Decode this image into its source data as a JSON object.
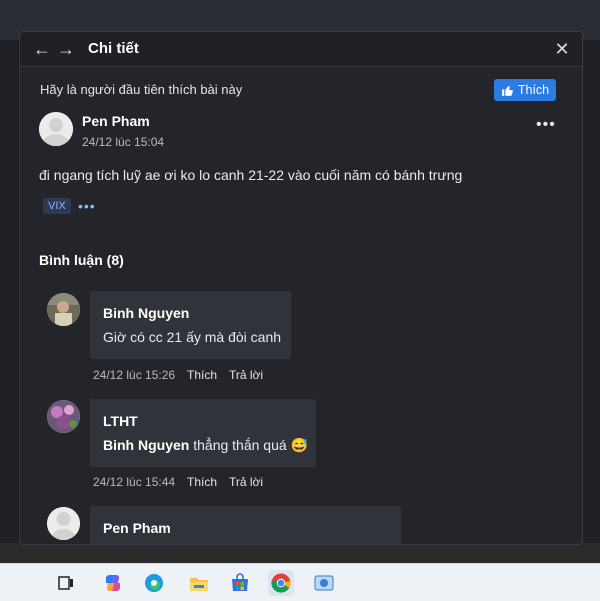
{
  "modal": {
    "title": "Chi tiết",
    "like_prompt": "Hãy là người đầu tiên thích bài này",
    "like_button": "Thích"
  },
  "post": {
    "author": "Pen Pham",
    "timestamp": "24/12 lúc 15:04",
    "text": "đi ngang tích luỹ ae ơi ko lo canh 21-22 vào cuối năm có bánh trưng",
    "tag": "VIX",
    "tag_more": "•••",
    "more": "•••"
  },
  "comments_header": "Bình luận (8)",
  "comments": [
    {
      "name": "Binh Nguyen",
      "text": "Giờ có cc 21 ấy mà đòi canh",
      "time": "24/12 lúc 15:26",
      "like": "Thích",
      "reply": "Trả lời"
    },
    {
      "name": "LTHT",
      "mention": "Binh Nguyen",
      "text": " thẳng thắn quá",
      "emoji": "😅",
      "time": "24/12 lúc 15:44",
      "like": "Thích",
      "reply": "Trả lời"
    },
    {
      "name": "Pen Pham"
    }
  ],
  "colors": {
    "accent": "#2c7be5",
    "modal_bg": "#23252b",
    "bubble_bg": "#30333a"
  },
  "icons": [
    "back-arrow-icon",
    "forward-arrow-icon",
    "close-icon",
    "thumbs-up-icon",
    "more-icon"
  ]
}
